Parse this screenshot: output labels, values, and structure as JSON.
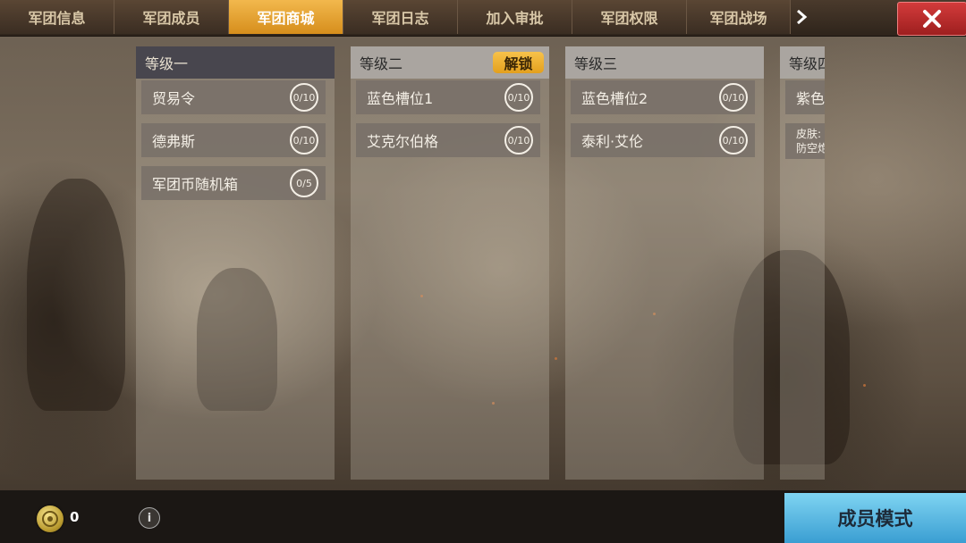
{
  "tabs": [
    "军团信息",
    "军团成员",
    "军团商城",
    "军团日志",
    "加入审批",
    "军团权限",
    "军团战场"
  ],
  "active_tab_index": 2,
  "tab_more_icon": "chevron-right-icon",
  "close_icon": "close-icon",
  "levels": [
    {
      "title": "等级一",
      "items": [
        {
          "name": "贸易令",
          "count": "0/10"
        },
        {
          "name": "德弗斯",
          "count": "0/10"
        },
        {
          "name": "军团币随机箱",
          "count": "0/5"
        }
      ]
    },
    {
      "title": "等级二",
      "unlock_label": "解锁",
      "items": [
        {
          "name": "蓝色槽位1",
          "count": "0/10"
        },
        {
          "name": "艾克尔伯格",
          "count": "0/10"
        }
      ]
    },
    {
      "title": "等级三",
      "items": [
        {
          "name": "蓝色槽位2",
          "count": "0/10"
        },
        {
          "name": "泰利·艾伦",
          "count": "0/10"
        }
      ]
    },
    {
      "title": "等级四",
      "items": [
        {
          "name": "紫色",
          "line1": "",
          "line2": ""
        },
        {
          "name": "",
          "line1": "皮肤:",
          "line2": "防空炮"
        }
      ]
    }
  ],
  "currency": {
    "icon": "coin-icon",
    "amount": "0"
  },
  "info_icon_label": "i",
  "member_mode_label": "成员模式",
  "colors": {
    "active_tab": "#e8a02c",
    "close_button": "#c12d2d",
    "unlock_button": "#f0b533",
    "member_button": "#4aaede"
  }
}
